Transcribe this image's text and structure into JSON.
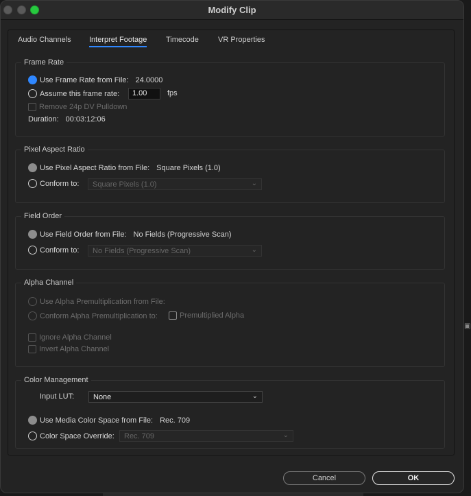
{
  "window": {
    "title": "Modify Clip"
  },
  "tabs": [
    {
      "label": "Audio Channels"
    },
    {
      "label": "Interpret Footage",
      "active": true
    },
    {
      "label": "Timecode"
    },
    {
      "label": "VR Properties"
    }
  ],
  "frame_rate": {
    "title": "Frame Rate",
    "use_file_label": "Use Frame Rate from File:",
    "use_file_value": "24.0000",
    "assume_label": "Assume this frame rate:",
    "assume_value": "1.00",
    "fps_unit": "fps",
    "pulldown_label": "Remove 24p DV Pulldown",
    "duration_label": "Duration:",
    "duration_value": "00:03:12:06"
  },
  "pixel_aspect": {
    "title": "Pixel Aspect Ratio",
    "use_file_label": "Use Pixel Aspect Ratio from File:",
    "use_file_value": "Square Pixels (1.0)",
    "conform_label": "Conform to:",
    "conform_value": "Square Pixels (1.0)"
  },
  "field_order": {
    "title": "Field Order",
    "use_file_label": "Use Field Order from File:",
    "use_file_value": "No Fields (Progressive Scan)",
    "conform_label": "Conform to:",
    "conform_value": "No Fields (Progressive Scan)"
  },
  "alpha": {
    "title": "Alpha Channel",
    "use_file_label": "Use Alpha Premultiplication from File:",
    "conform_label": "Conform Alpha Premultiplication to:",
    "premult_label": "Premultiplied Alpha",
    "ignore_label": "Ignore Alpha Channel",
    "invert_label": "Invert Alpha Channel"
  },
  "color": {
    "title": "Color Management",
    "lut_label": "Input LUT:",
    "lut_value": "None",
    "use_media_label": "Use Media Color Space from File:",
    "use_media_value": "Rec. 709",
    "override_label": "Color Space Override:",
    "override_value": "Rec. 709"
  },
  "buttons": {
    "cancel": "Cancel",
    "ok": "OK"
  },
  "colors": {
    "accent": "#2f87ff",
    "background": "#232323",
    "close_green": "#27c93f"
  }
}
